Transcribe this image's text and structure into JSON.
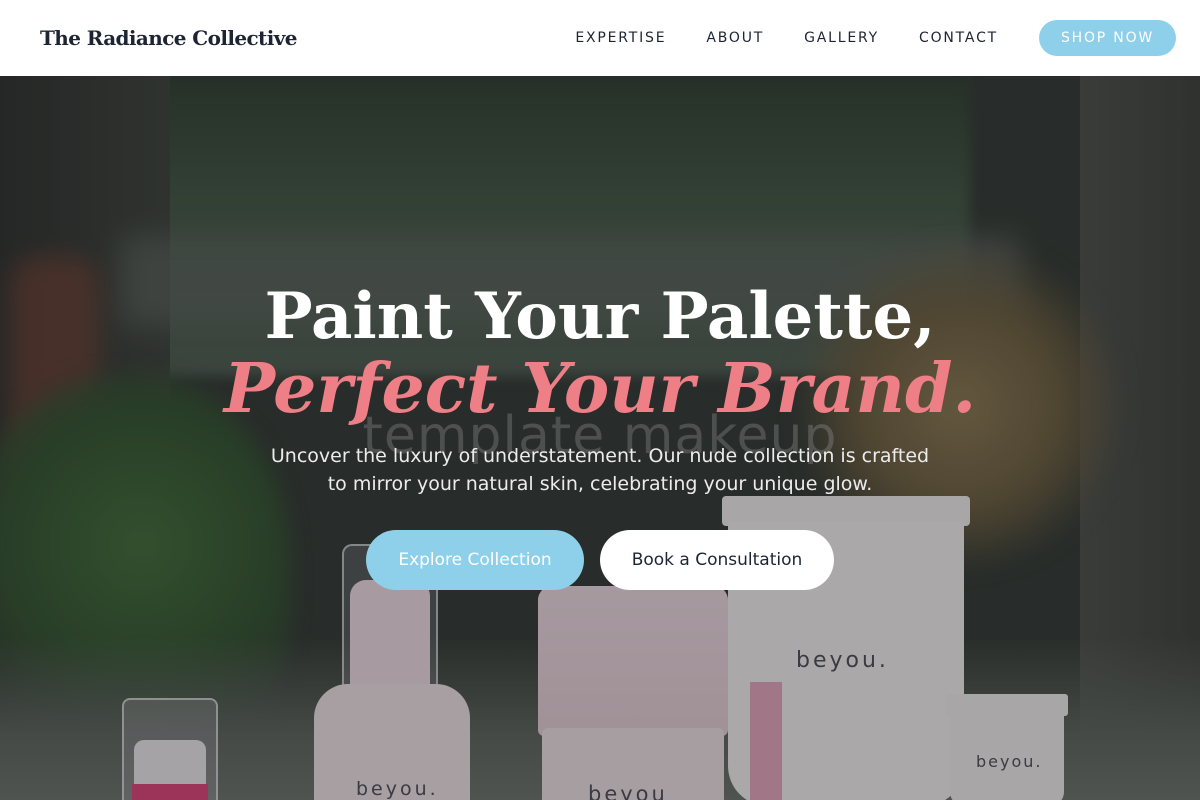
{
  "brand": {
    "name": "The Radiance Collective"
  },
  "nav": {
    "links": [
      "EXPERTISE",
      "ABOUT",
      "GALLERY",
      "CONTACT"
    ],
    "cta_label": "SHOP NOW"
  },
  "hero": {
    "headline": "Paint Your Palette,",
    "headline_accent": "Perfect Your Brand.",
    "watermark": "template makeup",
    "subtext": "Uncover the luxury of understatement. Our nude collection is crafted to mirror your natural skin, celebrating your unique glow.",
    "primary_button": "Explore Collection",
    "secondary_button": "Book a Consultation"
  },
  "products": {
    "label_pump": "beyou.",
    "label_jar": "beyou",
    "label_tube": "beyou.",
    "label_minitube": "beyou."
  },
  "colors": {
    "accent_blue": "#8ecfea",
    "accent_pink": "#ee7f86",
    "text_dark": "#1d2433"
  }
}
